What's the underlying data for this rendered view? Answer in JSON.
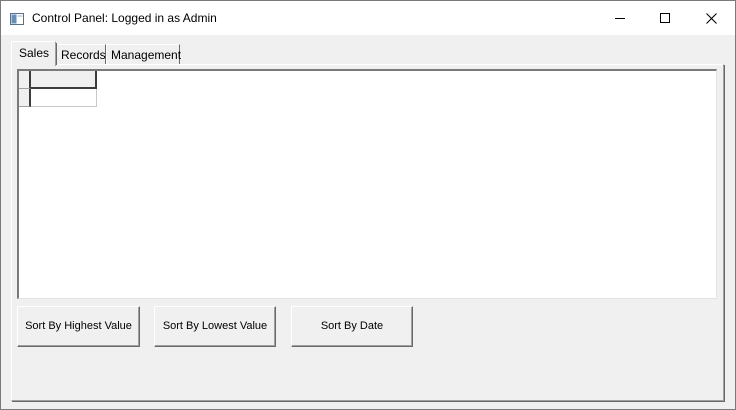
{
  "window": {
    "title": "Control Panel: Logged in as Admin"
  },
  "tabs": [
    {
      "label": "Sales",
      "selected": true
    },
    {
      "label": "Records",
      "selected": false
    },
    {
      "label": "Management",
      "selected": false
    }
  ],
  "grid": {
    "columns": [
      ""
    ],
    "rows": [
      [
        ""
      ]
    ]
  },
  "buttons": {
    "sort_highest": "Sort By Highest Value",
    "sort_lowest": "Sort By Lowest Value",
    "sort_date": "Sort By Date"
  },
  "icons": {
    "app": "window-app-icon",
    "minimize": "minimize-icon",
    "maximize": "maximize-icon",
    "close": "close-icon"
  },
  "colors": {
    "titlebar": "#ffffff",
    "window_background": "#f0f0f0",
    "grid_background": "#ffffff"
  }
}
